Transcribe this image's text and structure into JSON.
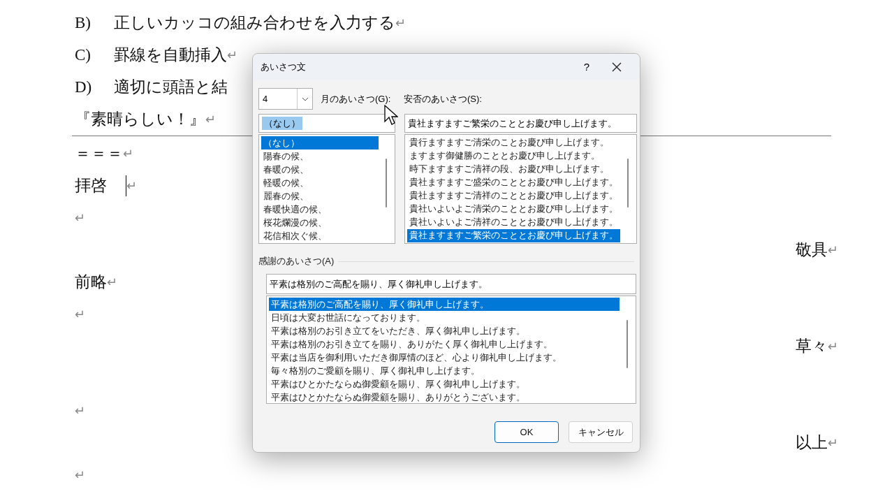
{
  "document": {
    "paragraphs": [
      {
        "kind": "text",
        "label": "B)",
        "text": "正しいカッコの組み合わせを入力する",
        "mark": "↵"
      },
      {
        "kind": "text",
        "label": "C)",
        "text": "罫線を自動挿入",
        "mark": "↵"
      },
      {
        "kind": "text",
        "label": "D)",
        "text": "適切に頭語と結"
      },
      {
        "kind": "text",
        "text": "『素晴らしい！』",
        "mark": "↵"
      },
      {
        "kind": "rule"
      },
      {
        "kind": "text",
        "text": "＝＝＝",
        "mark": "↵"
      },
      {
        "kind": "text",
        "text": "拝啓",
        "caret": true,
        "mark": "↵"
      },
      {
        "kind": "text",
        "mark": "↵"
      },
      {
        "kind": "right",
        "text": "敬具",
        "mark": "↵"
      },
      {
        "kind": "text",
        "text": "前略",
        "mark": "↵"
      },
      {
        "kind": "text",
        "mark": "↵"
      },
      {
        "kind": "right",
        "text": "草々",
        "mark": "↵"
      },
      {
        "kind": "blank"
      },
      {
        "kind": "text",
        "mark": "↵"
      },
      {
        "kind": "right",
        "text": "以上",
        "mark": "↵"
      },
      {
        "kind": "text",
        "mark": "↵"
      }
    ]
  },
  "dialog": {
    "title": "あいさつ文",
    "help": "?",
    "month": {
      "value": "4"
    },
    "month_label": "月のあいさつ(G):",
    "month_edit": {
      "value": "（なし）"
    },
    "month_list": [
      {
        "text": "（なし）",
        "selected": true
      },
      {
        "text": "陽春の候、",
        "selected": false
      },
      {
        "text": "春暖の候、",
        "selected": false
      },
      {
        "text": "軽暖の候、",
        "selected": false
      },
      {
        "text": "麗春の候、",
        "selected": false
      },
      {
        "text": "春暖快適の候、",
        "selected": false
      },
      {
        "text": "桜花爛漫の候、",
        "selected": false
      },
      {
        "text": "花信相次ぐ候、",
        "selected": false
      }
    ],
    "wellbeing_label": "安否のあいさつ(S):",
    "wellbeing_edit": {
      "value": "貴社ますますご繁栄のこととお慶び申し上げます。"
    },
    "wellbeing_list": [
      {
        "text": "貴行ますますご清栄のことお慶び申し上げます。",
        "selected": false
      },
      {
        "text": "ますます御健勝のこととお慶び申し上げます。",
        "selected": false
      },
      {
        "text": "時下ますますご清祥の段、お慶び申し上げます。",
        "selected": false
      },
      {
        "text": "貴社ますますご盛栄のこととお慶び申し上げます。",
        "selected": false
      },
      {
        "text": "貴社ますますご清祥のこととお慶び申し上げます。",
        "selected": false
      },
      {
        "text": "貴社いよいよご清栄のこととお慶び申し上げます。",
        "selected": false
      },
      {
        "text": "貴社いよいよご清祥のこととお慶び申し上げます。",
        "selected": false
      },
      {
        "text": "貴社ますますご繁栄のこととお慶び申し上げます。",
        "selected": true
      }
    ],
    "thanks_label": "感謝のあいさつ(A)",
    "thanks_edit": {
      "value": "平素は格別のご高配を賜り、厚く御礼申し上げます。"
    },
    "thanks_list": [
      {
        "text": "平素は格別のご高配を賜り、厚く御礼申し上げます。",
        "selected": true
      },
      {
        "text": "日頃は大変お世話になっております。",
        "selected": false
      },
      {
        "text": "平素は格別のお引き立てをいただき、厚く御礼申し上げます。",
        "selected": false
      },
      {
        "text": "平素は格別のお引き立てを賜り、ありがたく厚く御礼申し上げます。",
        "selected": false
      },
      {
        "text": "平素は当店を御利用いただき御厚情のほど、心より御礼申し上げます。",
        "selected": false
      },
      {
        "text": "毎々格別のご愛顧を賜り、厚く御礼申し上げます。",
        "selected": false
      },
      {
        "text": "平素はひとかたならぬ御愛顧を賜り、厚く御礼申し上げます。",
        "selected": false
      },
      {
        "text": "平素はひとかたならぬ御愛顧を賜り、ありがとうございます。",
        "selected": false
      }
    ],
    "buttons": [
      "OK",
      "キャンセル"
    ]
  }
}
